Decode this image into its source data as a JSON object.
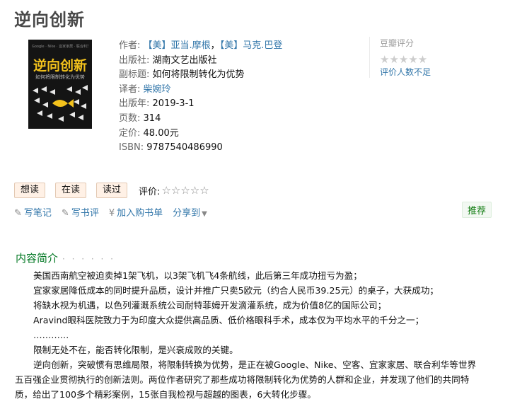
{
  "book": {
    "title": "逆向创新",
    "cover": {
      "top_line": "Google · Nike · 宜家家居 · 联合利华 · 美国西南航空",
      "title": "逆向创新",
      "subtitle": "如何将限制转化为优势"
    },
    "info": {
      "author_label": "作者:",
      "author_1": "【美】亚当.摩根",
      "author_sep": "，",
      "author_2": "【美】马克.巴登",
      "publisher_label": "出版社:",
      "publisher": "湖南文艺出版社",
      "subtitle_label": "副标题:",
      "subtitle": "如何将限制转化为优势",
      "translator_label": "译者:",
      "translator": "柴婉玲",
      "year_label": "出版年:",
      "year": "2019-3-1",
      "pages_label": "页数:",
      "pages": "314",
      "price_label": "定价:",
      "price": "48.00元",
      "isbn_label": "ISBN:",
      "isbn": "9787540486990"
    }
  },
  "rating": {
    "title": "豆瓣评分",
    "stars": "★★★★★",
    "note": "评价人数不足"
  },
  "actions": {
    "want": "想读",
    "reading": "在读",
    "read": "读过",
    "rate_label": "评价:",
    "rate_stars": "☆☆☆☆☆"
  },
  "links": {
    "write_note": "写笔记",
    "write_review": "写书评",
    "add_cart": "加入购书单",
    "share": "分享到",
    "recommend": "推荐"
  },
  "intro": {
    "title": "内容简介",
    "dots": "· · · · · ·",
    "lines": [
      "美国西南航空被迫卖掉1架飞机，以3架飞机飞4条航线，此后第三年成功扭亏为盈；",
      "宜家家居降低成本的同时提升品质，设计并推广只卖5欧元（约合人民币39.25元）的桌子，大获成功；",
      "将缺水视为机遇，以色列灌溉系统公司耐特菲姆开发滴灌系统，成为价值8亿的国际公司；",
      "Aravind眼科医院致力于为印度大众提供高品质、低价格眼科手术，成本仅为平均水平的千分之一；",
      "…………",
      "限制无处不在，能否转化限制，是兴衰成败的关键。",
      "逆向创新，突破惯有思维局限，将限制转换为优势，是正在被Google、Nike、空客、宜家家居、联合利华等世界",
      "五百强企业贯彻执行的创新法则。两位作者研究了那些成功将限制转化为优势的人群和企业，并发现了他们的共同特",
      "质，给出了100多个精彩案例，15张自我检视与超越的图表，6大转化步骤。"
    ]
  }
}
